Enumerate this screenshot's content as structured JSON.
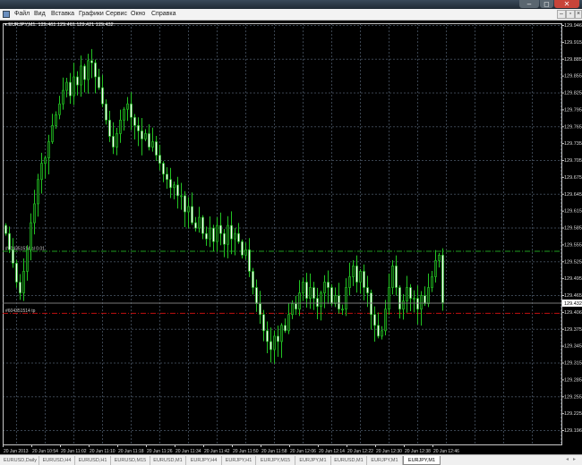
{
  "window": {
    "buttons": [
      "–",
      "◻",
      "✕"
    ]
  },
  "menu": [
    "Файл",
    "Вид",
    "Вставка",
    "Графики",
    "Сервис",
    "Окно",
    "Справка"
  ],
  "mdi_buttons": [
    "–",
    "▫",
    "×"
  ],
  "chart_header": {
    "symbol": "EURJPY,M1",
    "ohlc": "129.461 129.461 129.421 129.432"
  },
  "order_lines": [
    {
      "label": "#604351514 sl 0.01",
      "price": 129.528,
      "color": "#1f9b1f"
    },
    {
      "label": "#604351514 tp",
      "price": 129.413,
      "color": "#c01010"
    }
  ],
  "current_price": "129.432",
  "colors": {
    "bull_body": "#0a3a0a",
    "bear_body": "#ffffff",
    "outline": "#22c322",
    "grid": "#3a4450",
    "axis": "#c8c8c8"
  },
  "chart_data": {
    "type": "candlestick",
    "timeframe": "M1",
    "ylim": [
      129.196,
      129.946
    ],
    "price_labels": [
      "129.946",
      "129.915",
      "129.885",
      "129.855",
      "129.825",
      "129.795",
      "129.765",
      "129.735",
      "129.705",
      "129.675",
      "129.645",
      "129.615",
      "129.585",
      "129.555",
      "129.525",
      "129.495",
      "129.465",
      "129.406",
      "129.375",
      "129.345",
      "129.315",
      "129.285",
      "129.255",
      "129.225",
      "129.196"
    ],
    "time_labels": [
      "20 Jun 2013",
      "20 Jun 10:54",
      "20 Jun 11:02",
      "20 Jun 11:10",
      "20 Jun 11:18",
      "20 Jun 11:26",
      "20 Jun 11:34",
      "20 Jun 11:42",
      "20 Jun 11:50",
      "20 Jun 11:58",
      "20 Jun 12:06",
      "20 Jun 12:14",
      "20 Jun 12:22",
      "20 Jun 12:30",
      "20 Jun 12:38",
      "20 Jun 12:46"
    ],
    "first_open": 129.575,
    "closes": [
      129.56,
      129.53,
      129.505,
      129.47,
      129.45,
      129.49,
      129.53,
      129.58,
      129.615,
      129.66,
      129.69,
      129.7,
      129.73,
      129.76,
      129.78,
      129.8,
      129.825,
      129.84,
      129.815,
      129.85,
      129.835,
      129.87,
      129.845,
      129.88,
      129.876,
      129.85,
      129.83,
      129.8,
      129.77,
      129.74,
      129.72,
      129.745,
      129.77,
      129.79,
      129.8,
      129.775,
      129.76,
      129.75,
      129.735,
      129.745,
      129.72,
      129.73,
      129.705,
      129.69,
      129.67,
      129.66,
      129.645,
      129.65,
      129.63,
      129.63,
      129.6,
      129.61,
      129.58,
      129.57,
      129.59,
      129.56,
      129.55,
      129.57,
      129.545,
      129.575,
      129.56,
      129.54,
      129.575,
      129.55,
      129.56,
      129.545,
      129.52,
      129.53,
      129.49,
      129.46,
      129.43,
      129.41,
      129.38,
      129.36,
      129.345,
      129.37,
      129.36,
      129.39,
      129.38,
      129.41,
      129.43,
      129.42,
      129.45,
      129.47,
      129.44,
      129.46,
      129.44,
      129.425,
      129.45,
      129.47,
      129.46,
      129.43,
      129.445,
      129.42,
      129.42,
      129.46,
      129.48,
      129.5,
      129.47,
      129.49,
      129.46,
      129.45,
      129.41,
      129.39,
      129.37,
      129.38,
      129.42,
      129.46,
      129.5,
      129.46,
      129.42,
      129.435,
      129.46,
      129.44,
      129.44,
      129.42,
      129.445,
      129.43,
      129.46,
      129.48,
      129.51,
      129.52,
      129.432
    ]
  },
  "tabs": [
    "EURUSD,Daily",
    "EURUSD,H4",
    "EURUSD,H1",
    "EURUSD,M15",
    "EURUSD,M1",
    "EURJPY,H4",
    "EURJPY,H1",
    "EURJPY,M15",
    "EURJPY,M1",
    "EURUSD,M1",
    "EURJPY,M1",
    "EURJPY,M1"
  ],
  "active_tab": 11,
  "tab_scroll": [
    "◂",
    "▸"
  ]
}
